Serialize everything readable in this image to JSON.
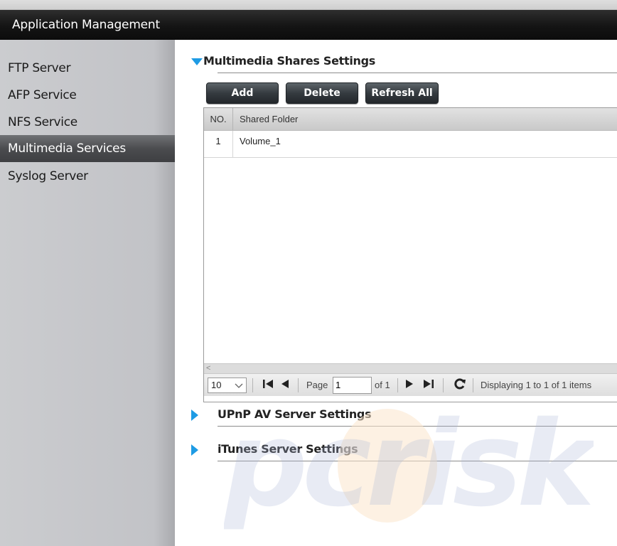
{
  "header": {
    "title": "Application Management"
  },
  "sidebar": {
    "items": [
      {
        "label": "FTP Server",
        "active": false
      },
      {
        "label": "AFP Service",
        "active": false
      },
      {
        "label": "NFS Service",
        "active": false
      },
      {
        "label": "Multimedia Services",
        "active": true
      },
      {
        "label": "Syslog Server",
        "active": false
      }
    ]
  },
  "sections": {
    "multimedia": {
      "label": "Multimedia Shares Settings",
      "expanded": true
    },
    "upnp": {
      "label": "UPnP AV Server Settings",
      "expanded": false
    },
    "itunes": {
      "label": "iTunes Server Settings",
      "expanded": false
    }
  },
  "toolbar": {
    "add_label": "Add",
    "delete_label": "Delete",
    "refresh_label": "Refresh All"
  },
  "grid": {
    "columns": [
      "NO.",
      "Shared Folder"
    ],
    "rows": [
      {
        "no": "1",
        "folder": "Volume_1"
      }
    ]
  },
  "pager": {
    "page_size": "10",
    "page_label": "Page",
    "page_value": "1",
    "of_label": "of 1",
    "status": "Displaying 1 to 1 of 1 items"
  },
  "watermark": {
    "text": "pcrisk"
  },
  "colors": {
    "accent_arrow": "#1e9be4",
    "header": "#141414",
    "sidebar_active": "#4b4c4f"
  }
}
